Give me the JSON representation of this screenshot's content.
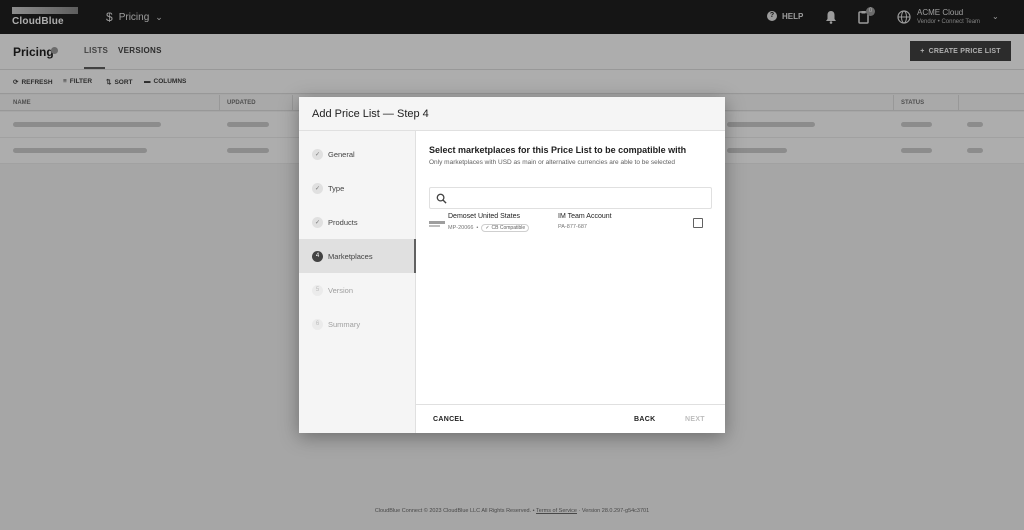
{
  "topbar": {
    "logo_text": "CloudBlue",
    "module_label": "Pricing",
    "help_label": "HELP",
    "notifications_count": "0",
    "account_name": "ACME Cloud",
    "account_role": "Vendor • Connect Team"
  },
  "page": {
    "title": "Pricing",
    "tabs": [
      {
        "label": "LISTS"
      },
      {
        "label": "VERSIONS"
      }
    ],
    "create_button": "CREATE PRICE LIST"
  },
  "toolbar": {
    "refresh": "REFRESH",
    "filter": "FILTER",
    "sort": "SORT",
    "columns": "COLUMNS"
  },
  "table": {
    "columns": [
      "NAME",
      "UPDATED",
      "STATUS"
    ]
  },
  "dialog": {
    "title": "Add Price List — Step 4",
    "steps": [
      {
        "label": "General",
        "state": "done"
      },
      {
        "label": "Type",
        "state": "done"
      },
      {
        "label": "Products",
        "state": "done"
      },
      {
        "label": "Marketplaces",
        "state": "active",
        "number": "4"
      },
      {
        "label": "Version",
        "state": "disabled",
        "number": "5"
      },
      {
        "label": "Summary",
        "state": "disabled",
        "number": "6"
      }
    ],
    "heading": "Select marketplaces for this Price List to be compatible with",
    "subheading": "Only marketplaces with USD as main or alternative currencies are able to be selected",
    "search_placeholder": "",
    "marketplace": {
      "name": "Demoset United States",
      "id": "MP-20066",
      "badge": "CB Compatible",
      "account_name": "IM Team Account",
      "account_id": "PA-877-687"
    },
    "cancel": "CANCEL",
    "back": "BACK",
    "next": "NEXT"
  },
  "footer": {
    "copyright": "CloudBlue Connect © 2023 CloudBlue LLC All Rights Reserved. •",
    "terms": "Terms of Service",
    "version": "· Version 28.0.297-g54c3701"
  },
  "colors": {
    "topbar": "#1f1f1f",
    "accent": "#424242",
    "overlay": "rgba(0,0,0,0.32)"
  }
}
